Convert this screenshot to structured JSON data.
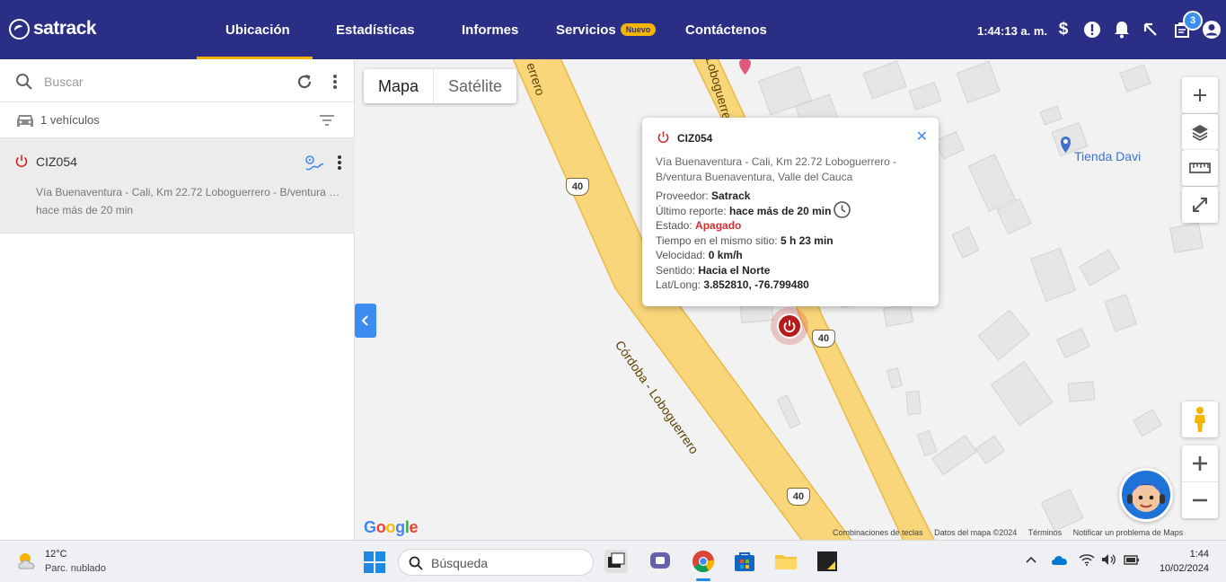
{
  "header": {
    "brand": "satrack",
    "nav": [
      "Ubicación",
      "Estadísticas",
      "Informes",
      "Servicios",
      "Contáctenos"
    ],
    "badge_new": "Nuevo",
    "clock": "1:44:13 a. m.",
    "notification_count": "3"
  },
  "sidebar": {
    "search_placeholder": "Buscar",
    "vehicle_count": "1 vehículos",
    "vehicles": [
      {
        "plate": "CIZ054",
        "address": "Vía Buenaventura - Cali, Km 22.72 Loboguerrero - B/ventura Buenaventura, Valle del Cauca",
        "time": "hace más de 20 min"
      }
    ]
  },
  "map": {
    "type_toggle": [
      "Mapa",
      "Satélite"
    ],
    "poi": "Tienda Davi",
    "road_labels": [
      "errero",
      "Loboguerrero",
      "Córdoba - Loboguerrero"
    ],
    "route_number": "40",
    "google": "Google",
    "attribution": [
      "Combinaciones de teclas",
      "Datos del mapa ©2024",
      "Términos",
      "Notificar un problema de Maps"
    ],
    "popup": {
      "plate": "CIZ054",
      "address": "Vía Buenaventura - Cali, Km 22.72 Loboguerrero - B/ventura Buenaventura, Valle del Cauca",
      "provider_label": "Proveedor:",
      "provider": "Satrack",
      "last_report_label": "Último reporte:",
      "last_report": "hace más de 20 min",
      "status_label": "Estado:",
      "status": "Apagado",
      "same_site_label": "Tiempo en el mismo sitio:",
      "same_site": "5 h 23 min",
      "speed_label": "Velocidad:",
      "speed": "0 km/h",
      "direction_label": "Sentido:",
      "direction": "Hacia el Norte",
      "latlong_label": "Lat/Long:",
      "latlong": "3.852810, -76.799480"
    }
  },
  "taskbar": {
    "weather_temp": "12°C",
    "weather_desc": "Parc. nublado",
    "search": "Búsqueda",
    "time": "1:44",
    "date": "10/02/2024"
  },
  "colors": {
    "header_bg": "#2a2f85",
    "accent_yellow": "#f4b400",
    "blue": "#3d8cf0",
    "status_red": "#d32f2f",
    "road": "#fad67a"
  }
}
